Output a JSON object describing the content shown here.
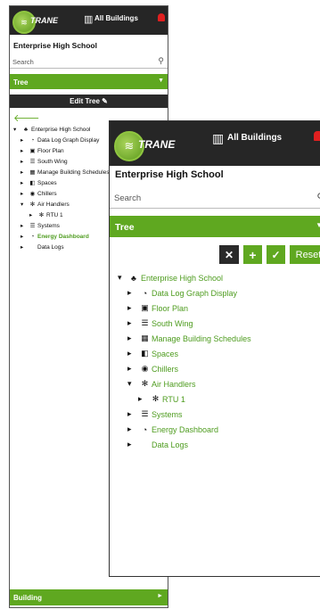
{
  "header": {
    "logo_text": "TRANE",
    "buildings_label": "All Buildings"
  },
  "site_title": "Enterprise High School",
  "search": {
    "placeholder": "Search"
  },
  "sections": {
    "tree": "Tree",
    "building": "Building"
  },
  "edit_tree_label": "Edit Tree",
  "tree": {
    "root": "Enterprise High School",
    "items": [
      "Data Log Graph Display",
      "Floor Plan",
      "South Wing",
      "Manage Building Schedules",
      "Spaces",
      "Chillers",
      "Air Handlers",
      "RTU 1",
      "Systems",
      "Energy Dashboard",
      "Data Logs"
    ]
  },
  "toolbar": {
    "cancel": "✕",
    "add": "+",
    "apply": "✓",
    "reset": "Reset"
  },
  "colors": {
    "brand_green": "#5fa820",
    "header_dark": "#262626",
    "link_green": "#4e9c1f"
  },
  "icons": {
    "tree": "tree-icon",
    "chart": "gauge-icon",
    "floor": "image-icon",
    "wing": "list-icon",
    "schedule": "calendar-icon",
    "spaces": "spaces-icon",
    "chillers": "chiller-icon",
    "ahu": "fan-icon",
    "rtu": "fan-icon",
    "systems": "list-icon",
    "energy": "gauge-icon"
  }
}
